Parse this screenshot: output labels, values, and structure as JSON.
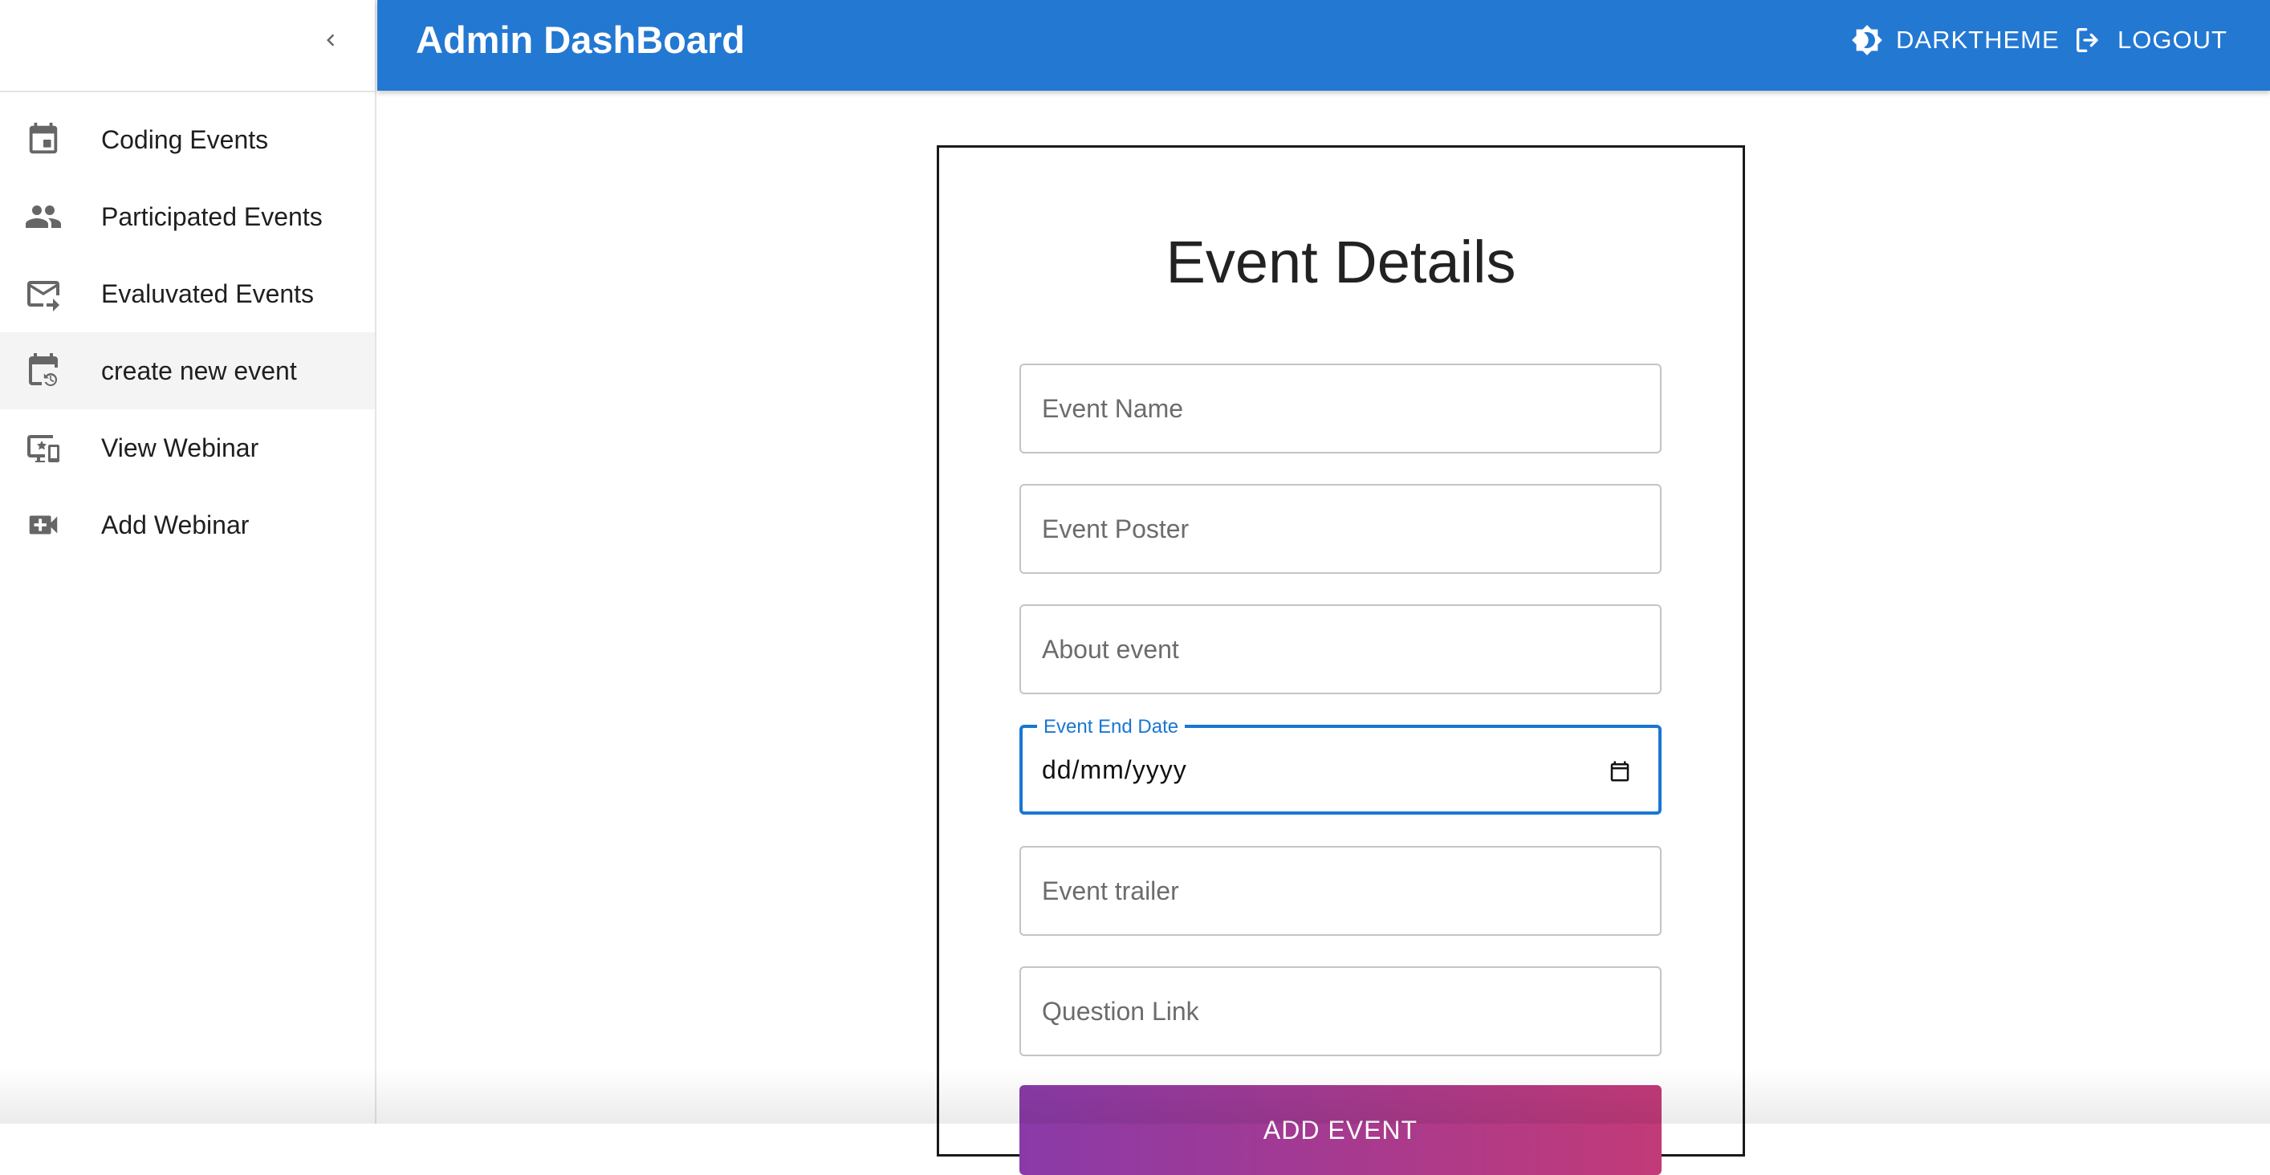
{
  "header": {
    "title": "Admin DashBoard",
    "theme_label": "DARKTHEME",
    "logout_label": "LOGOUT",
    "bar_color": "#2378d2"
  },
  "sidebar": {
    "collapse_icon": "chevron-left-icon",
    "items": [
      {
        "label": "Coding Events",
        "icon": "event-calendar-icon",
        "active": false
      },
      {
        "label": "Participated Events",
        "icon": "people-icon",
        "active": false
      },
      {
        "label": "Evaluvated Events",
        "icon": "mail-forward-icon",
        "active": false
      },
      {
        "label": "create new event",
        "icon": "calendar-history-icon",
        "active": true
      },
      {
        "label": "View Webinar",
        "icon": "monitor-star-icon",
        "active": false
      },
      {
        "label": "Add Webinar",
        "icon": "video-add-icon",
        "active": false
      }
    ]
  },
  "form": {
    "title": "Event Details",
    "fields": {
      "event_name": {
        "placeholder": "Event Name",
        "value": ""
      },
      "event_poster": {
        "placeholder": "Event Poster",
        "value": ""
      },
      "about_event": {
        "placeholder": "About event",
        "value": ""
      },
      "event_end_date": {
        "label": "Event End Date",
        "value": "dd/mm/yyyy"
      },
      "event_trailer": {
        "placeholder": "Event trailer",
        "value": ""
      },
      "question_link": {
        "placeholder": "Question Link",
        "value": ""
      }
    },
    "submit_label": "ADD EVENT",
    "focus_color": "#1976d2"
  }
}
